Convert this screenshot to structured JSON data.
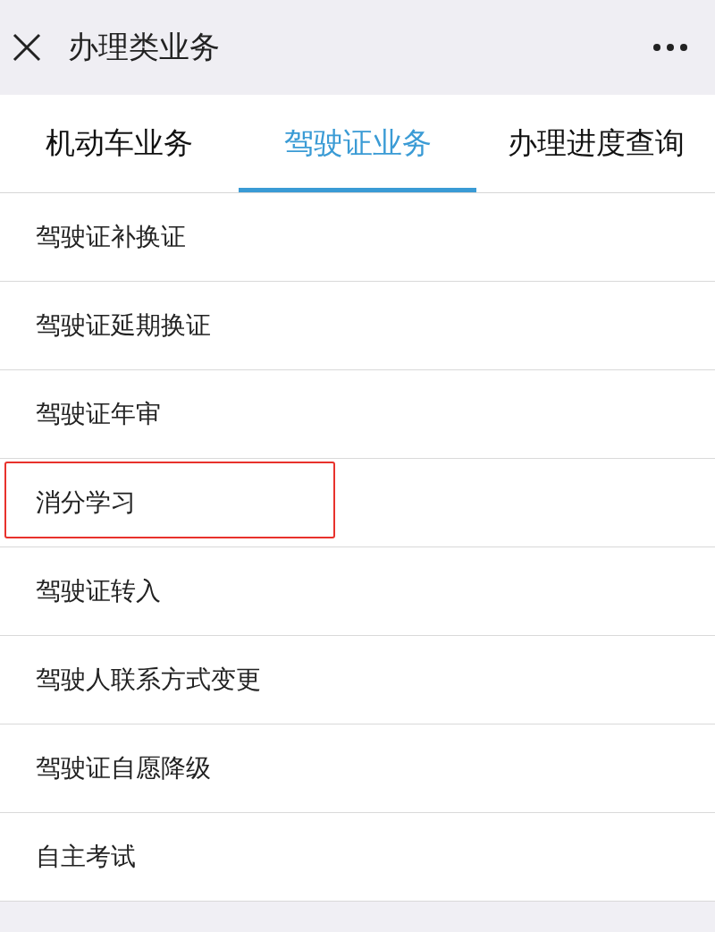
{
  "header": {
    "title": "办理类业务"
  },
  "tabs": [
    {
      "label": "机动车业务",
      "selected": false
    },
    {
      "label": "驾驶证业务",
      "selected": true
    },
    {
      "label": "办理进度查询",
      "selected": false
    }
  ],
  "items": [
    {
      "label": "驾驶证补换证",
      "highlighted": false
    },
    {
      "label": "驾驶证延期换证",
      "highlighted": false
    },
    {
      "label": "驾驶证年审",
      "highlighted": false
    },
    {
      "label": "消分学习",
      "highlighted": true
    },
    {
      "label": "驾驶证转入",
      "highlighted": false
    },
    {
      "label": "驾驶人联系方式变更",
      "highlighted": false
    },
    {
      "label": "驾驶证自愿降级",
      "highlighted": false
    },
    {
      "label": "自主考试",
      "highlighted": false
    }
  ]
}
